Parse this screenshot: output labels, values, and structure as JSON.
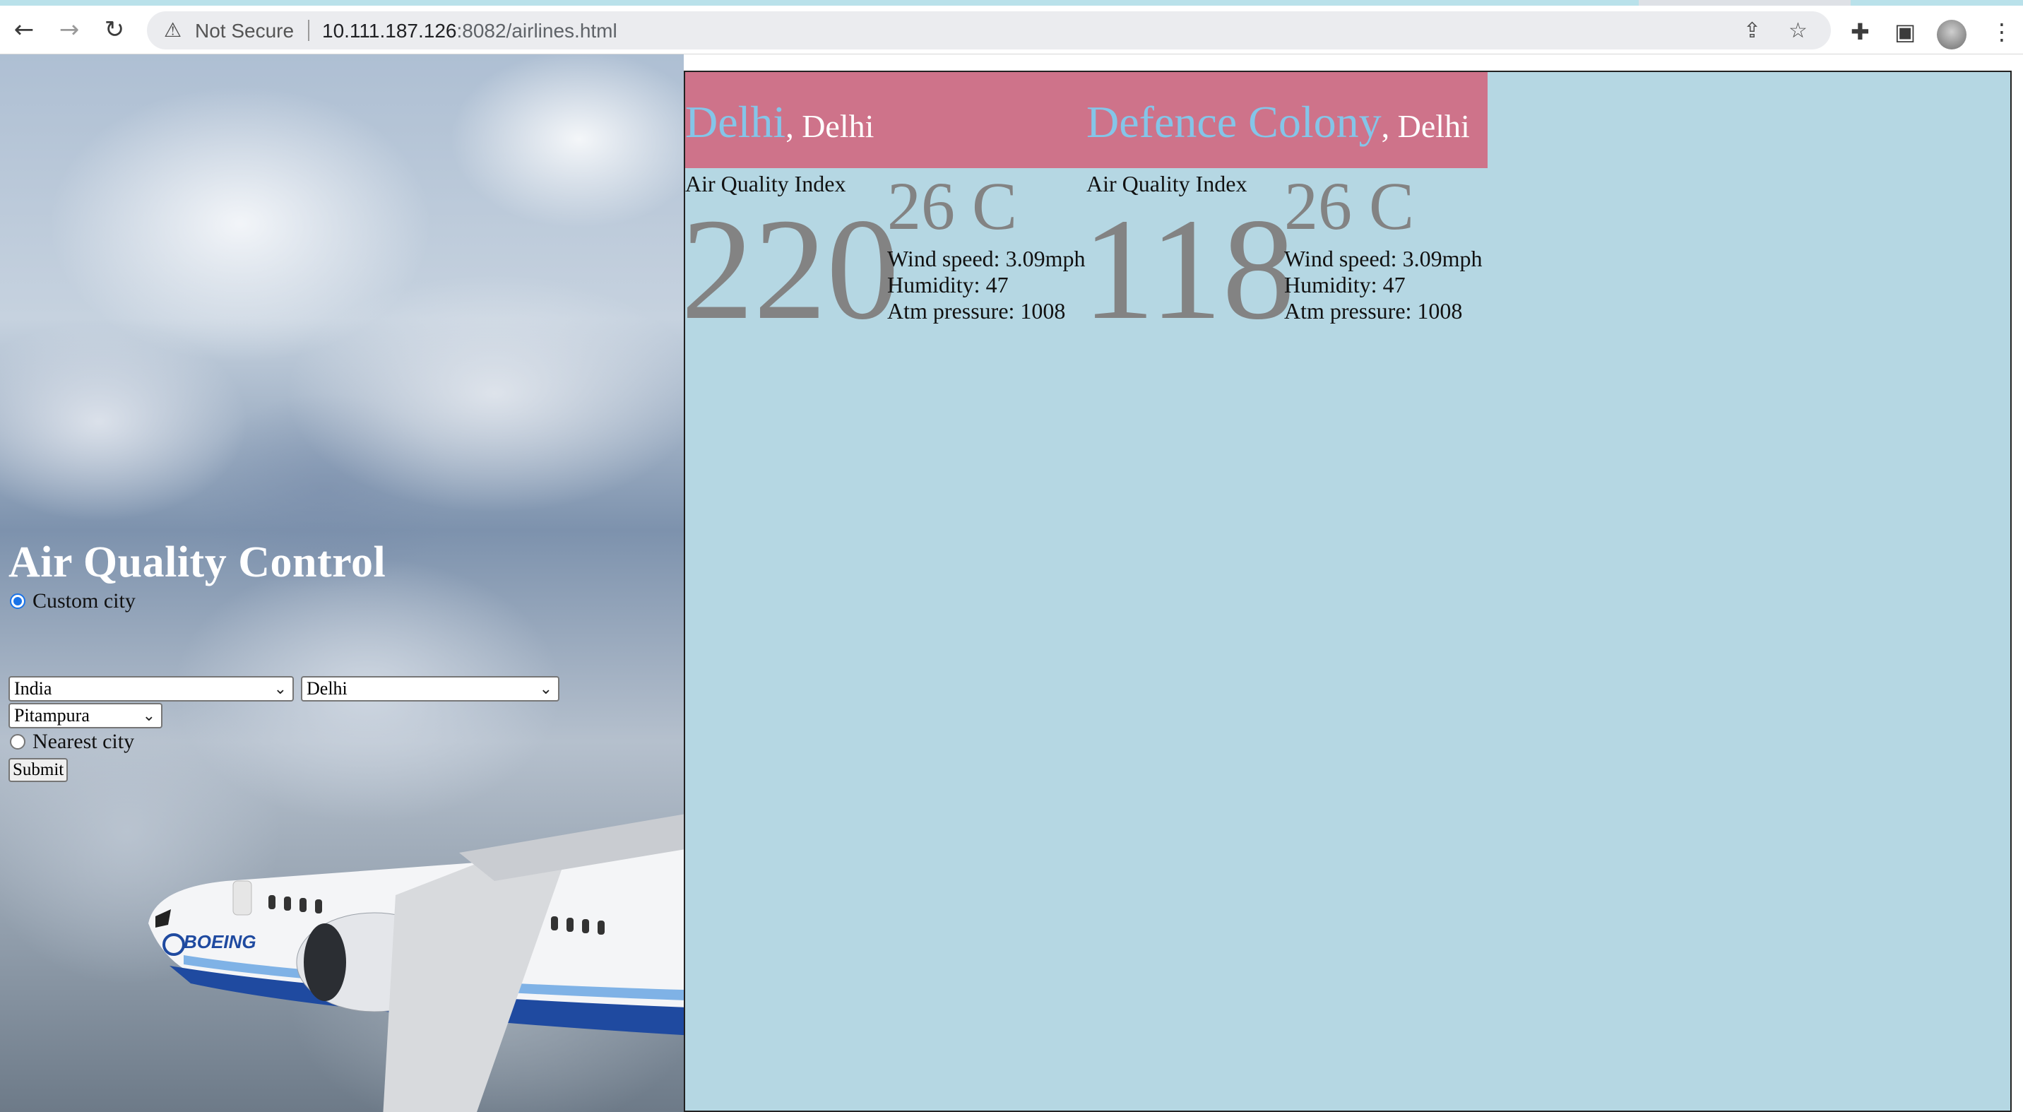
{
  "browser": {
    "security_label": "Not Secure",
    "url_host": "10.111.187.126",
    "url_path": ":8082/airlines.html",
    "icons": [
      "back-arrow-icon",
      "forward-arrow-icon",
      "reload-icon",
      "warning-icon",
      "share-icon",
      "star-icon",
      "extensions-icon",
      "side-panel-icon",
      "avatar",
      "kebab-menu-icon"
    ]
  },
  "form": {
    "title": "Air Quality Control",
    "custom_city_label": "Custom city",
    "custom_city_checked": true,
    "country_value": "India",
    "state_value": "Delhi",
    "city_value": "Pitampura",
    "nearest_city_label": "Nearest city",
    "nearest_city_checked": false,
    "submit_label": "Submit"
  },
  "cards": [
    {
      "station": "Delhi",
      "state": ", Delhi",
      "aqi_label": "Air Quality Index",
      "aqi": "220",
      "temperature": "26 C",
      "wind": "Wind speed: 3.09mph",
      "humidity": "Humidity: 47",
      "pressure": "Atm pressure: 1008"
    },
    {
      "station": "Defence Colony",
      "state": ", Delhi",
      "aqi_label": "Air Quality Index",
      "aqi": "118",
      "temperature": "26 C",
      "wind": "Wind speed: 3.09mph",
      "humidity": "Humidity: 47",
      "pressure": "Atm pressure: 1008"
    }
  ],
  "colors": {
    "card_header": "#ce738a",
    "station_text": "#84c5e8",
    "results_background": "#b5d7e3",
    "value_gray": "#838383"
  }
}
